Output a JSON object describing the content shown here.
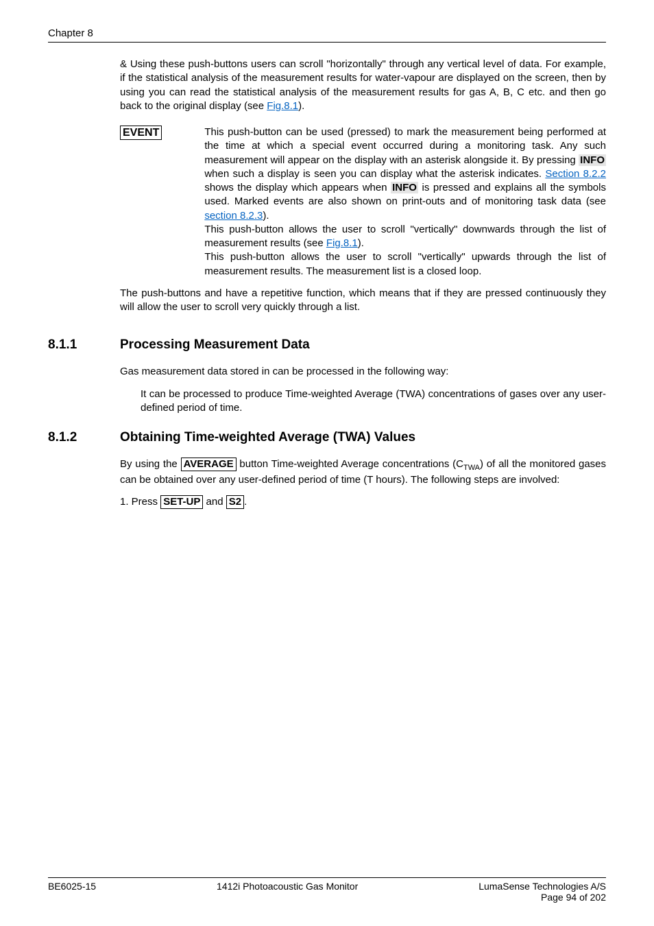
{
  "header": {
    "chapter": "Chapter 8"
  },
  "para_scroll": {
    "prefix": " &            Using these push-buttons users can scroll \"horizontally\" through any vertical level of data. For example, if the statistical analysis of the measurement results for water-vapour are displayed on the screen, then by using     you can read the statistical analysis of the measurement results for gas A, B, C etc. and then go back to the original display (see ",
    "link": "Fig.8.1",
    "suffix": ")."
  },
  "event": {
    "label": "EVENT",
    "p1a": "This push-button can be used (pressed) to mark the measurement being performed at the time at which a special event occurred during a monitoring task. Any such measurement will appear on the display with an asterisk alongside it. By pressing ",
    "info1": "INFO",
    "p1b": " when such a display is seen you can display what the asterisk indicates. ",
    "link_822": "Section 8.2.2",
    "p1c": " shows the display which appears when ",
    "info2": "INFO",
    "p1d": " is pressed and explains all the symbols used. Marked events are also shown on print-outs and of monitoring task data (see ",
    "link_823": "section 8.2.3",
    "p1e": ").",
    "p2a": "This push-button allows the user to scroll \"vertically\" downwards through the list of measurement results (see ",
    "link_fig": "Fig.8.1",
    "p2b": ").",
    "p3": "This push-button allows the user to scroll \"vertically\" upwards through the list of measurement results. The measurement list is a closed loop."
  },
  "push_para": "The push-buttons    and    have a repetitive function, which means that if they are pressed continuously they will allow the user to scroll very quickly through a list.",
  "sec811": {
    "num": "8.1.1",
    "title": "Processing Measurement Data",
    "p1": "Gas measurement data stored in                       can be processed in the following way:",
    "p2": "It can be processed to produce Time-weighted Average (TWA) concentrations of gases over any user-defined period of time."
  },
  "sec812": {
    "num": "8.1.2",
    "title": "Obtaining Time-weighted Average (TWA) Values",
    "p1a": "By using the ",
    "avg": "AVERAGE",
    "p1b": " button Time-weighted Average concentrations (C",
    "sub": "TWA",
    "p1c": ") of all the monitored gases can be obtained over any user-defined period of time (T hours). The following steps are involved:",
    "step_prefix": "1. Press ",
    "setup": "SET-UP",
    "and": " and ",
    "s2": "S2",
    "dot": "."
  },
  "footer": {
    "left": "BE6025-15",
    "center": "1412i Photoacoustic Gas Monitor",
    "right1": "LumaSense Technologies A/S",
    "right2": "Page 94 of 202"
  }
}
